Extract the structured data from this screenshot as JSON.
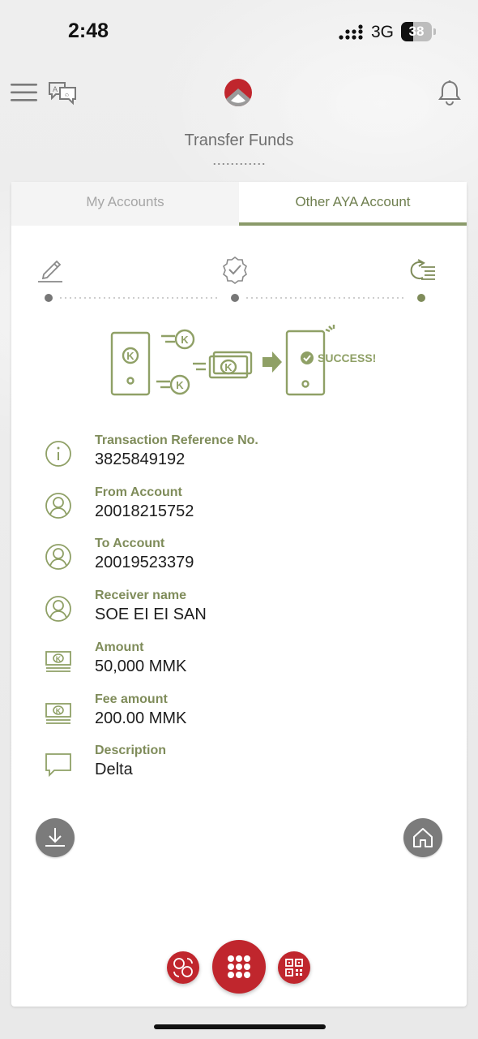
{
  "status_bar": {
    "time": "2:48",
    "network": "3G",
    "battery": "38"
  },
  "header": {
    "title": "Transfer Funds",
    "icons": [
      "menu-icon",
      "language-icon",
      "aya-logo",
      "bell-icon"
    ]
  },
  "tabs": [
    {
      "label": "My Accounts",
      "active": false
    },
    {
      "label": "Other AYA Account",
      "active": true
    }
  ],
  "stepper": {
    "steps": [
      "edit-icon",
      "verify-icon",
      "confirm-icon"
    ],
    "current_step": 3
  },
  "illustration": {
    "success_text": "SUCCESS!",
    "currency_symbol": "K"
  },
  "details": [
    {
      "label": "Transaction Reference No.",
      "value": "3825849192",
      "icon": "info-icon"
    },
    {
      "label": "From Account",
      "value": "20018215752",
      "icon": "user-icon"
    },
    {
      "label": "To Account",
      "value": "20019523379",
      "icon": "user-icon"
    },
    {
      "label": "Receiver name",
      "value": "SOE EI EI SAN",
      "icon": "user-icon"
    },
    {
      "label": "Amount",
      "value": "50,000 MMK",
      "icon": "money-icon"
    },
    {
      "label": "Fee amount",
      "value": "200.00 MMK",
      "icon": "money-icon"
    },
    {
      "label": "Description",
      "value": "Delta",
      "icon": "comment-icon"
    }
  ],
  "actions": {
    "download_icon": "download-icon",
    "home_icon": "home-icon"
  },
  "bottom_nav": {
    "items": [
      "transfer-icon",
      "grid-menu-icon",
      "qr-code-icon"
    ]
  },
  "colors": {
    "accent_green": "#7f8c5a",
    "brand_red": "#c0262d",
    "tab_underline": "#8a9a6a"
  }
}
